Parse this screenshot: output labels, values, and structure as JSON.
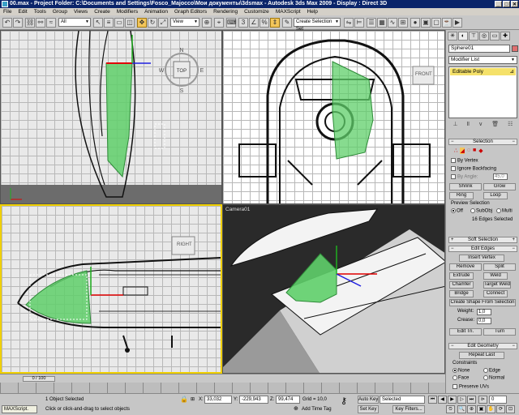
{
  "window": {
    "title": "00.max - Project Folder: C:\\Documents and Settings\\Fosco_Majocco\\Мои документы\\3dsmax - Autodesk 3ds Max 2009 - Display : Direct 3D",
    "min": "_",
    "max": "□",
    "close": "✕"
  },
  "menu": [
    "File",
    "Edit",
    "Tools",
    "Group",
    "Views",
    "Create",
    "Modifiers",
    "Animation",
    "Graph Editors",
    "Rendering",
    "Customize",
    "MAXScript",
    "Help"
  ],
  "toolbar": {
    "selection_filter": "All",
    "ref_coord": "View",
    "named_selection": "Create Selection Set"
  },
  "viewports": {
    "top": {
      "label": "",
      "viewcube": "TOP",
      "compass": {
        "n": "N",
        "s": "S",
        "e": "E",
        "w": "W"
      }
    },
    "front": {
      "label": "",
      "viewcube": "FRONT"
    },
    "right": {
      "label": "",
      "viewcube": "RIGHT"
    },
    "camera": {
      "label": "Camera01"
    }
  },
  "command_panel": {
    "object_name": "Sphere01",
    "modifier_list": "Modifier List",
    "stack": [
      "Editable Poly"
    ],
    "selection": {
      "title": "Selection",
      "by_vertex": "By Vertex",
      "ignore_backfacing": "Ignore Backfacing",
      "by_angle": "By Angle:",
      "by_angle_value": "45,0",
      "shrink": "Shrink",
      "grow": "Grow",
      "ring": "Ring",
      "loop": "Loop",
      "preview_selection": "Preview Selection",
      "off": "Off",
      "subobj": "SubObj",
      "multi": "Multi",
      "status": "16 Edges Selected"
    },
    "soft_selection": {
      "title": "Soft Selection"
    },
    "edit_edges": {
      "title": "Edit Edges",
      "insert_vertex": "Insert Vertex",
      "remove": "Remove",
      "split": "Split",
      "extrude": "Extrude",
      "weld": "Weld",
      "chamfer": "Chamfer",
      "target_weld": "Target Weld",
      "bridge": "Bridge",
      "connect": "Connect",
      "create_shape": "Create Shape From Selection",
      "weight": "Weight:",
      "weight_value": "1,0",
      "crease": "Crease:",
      "crease_value": "0,0",
      "edit_tri": "Edit Tri.",
      "turn": "Turn"
    },
    "edit_geometry": {
      "title": "Edit Geometry",
      "repeat_last": "Repeat Last",
      "constraints": "Constraints",
      "none": "None",
      "edge": "Edge",
      "face": "Face",
      "normal": "Normal",
      "preserve_uvs": "Preserve UVs"
    }
  },
  "timeline": {
    "slider": "0 / 100"
  },
  "status": {
    "maxscript": "MAXScript.",
    "selected": "1 Object Selected",
    "prompt": "Click or click-and-drag to select objects",
    "x_label": "X:",
    "x": "33,032",
    "y_label": "Y:",
    "y": "-229,943",
    "z_label": "Z:",
    "z": "99,474",
    "grid": "Grid = 10,0",
    "add_time_tag": "Add Time Tag",
    "auto_key": "Auto Key",
    "set_key": "Set Key",
    "key_selected": "Selected",
    "key_filters": "Key Filters...",
    "frame": "0"
  },
  "colors": {
    "selection_green": "#5fcf6a",
    "active_border": "#f0d000",
    "title_blue": "#0a246a",
    "stack_yellow": "#f5e16a"
  }
}
